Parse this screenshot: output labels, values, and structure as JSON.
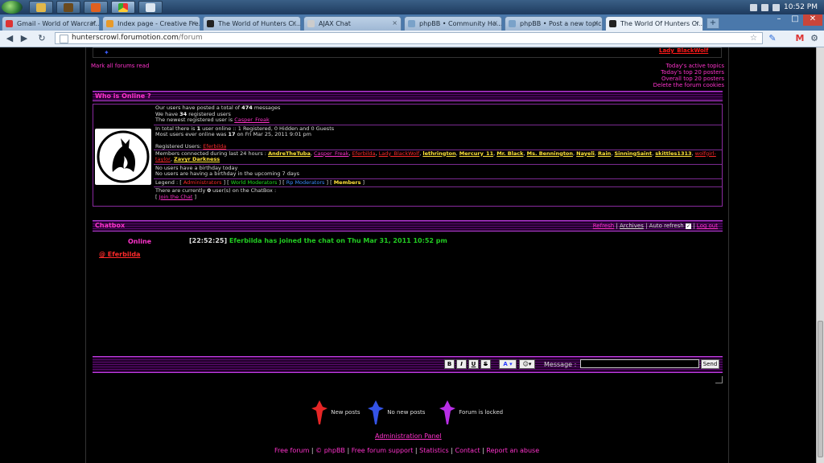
{
  "taskbar": {
    "time": "10:52 PM"
  },
  "browser": {
    "tabs": [
      {
        "label": "Gmail - World of Warcraf...",
        "color": "#d33"
      },
      {
        "label": "Index page - Creative Fre...",
        "color": "#e89a2a"
      },
      {
        "label": "The World of Hunters Cr...",
        "color": "#222"
      },
      {
        "label": "AJAX Chat",
        "color": "#ccc"
      },
      {
        "label": "phpBB • Community Ho...",
        "color": "#7aa2c9"
      },
      {
        "label": "phpBB • Post a new topic",
        "color": "#7aa2c9"
      },
      {
        "label": "The World Of Hunters Cr...",
        "color": "#222"
      }
    ],
    "url_host": "hunterscrowl.forumotion.com",
    "url_path": "/forum"
  },
  "forum": {
    "top_user": "Lady_BlackWolf",
    "mark_read": "Mark all forums read",
    "right_links": [
      "Today's active topics",
      "Today's top 20 posters",
      "Overall top 20 posters",
      "Delete the forum cookies"
    ],
    "who_title": "Who is Online ?",
    "stats": {
      "l1_pre": "Our users have posted a total of ",
      "posts": "474",
      "l1_post": " messages",
      "l2_pre": "We have ",
      "users": "34",
      "l2_post": " registered users",
      "l3_pre": "The newest registered user is ",
      "newest": "Casper_Freak",
      "l4_pre": "In total there is ",
      "online": "1",
      "l4_post": " user online :: 1 Registered, 0 Hidden and 0 Guests",
      "l5_pre": "Most users ever online was ",
      "max": "17",
      "l5_post": " on Fri Mar 25, 2011 9:01 pm",
      "registered_label": "Registered Users: ",
      "registered_user": "Eferbilda",
      "connected_label": "Members connected during last 24 hours : ",
      "connected": [
        {
          "name": "AndreTheTuba",
          "cls": "u-yel"
        },
        {
          "name": "Casper_Freak",
          "cls": "u-pink"
        },
        {
          "name": "Eferbilda",
          "cls": "u-red"
        },
        {
          "name": "Lady_BlackWolf",
          "cls": "u-red"
        },
        {
          "name": "lethrington",
          "cls": "u-yel"
        },
        {
          "name": "Mercury_11",
          "cls": "u-yel"
        },
        {
          "name": "Mr. Black",
          "cls": "u-yel"
        },
        {
          "name": "Ms. Bennington",
          "cls": "u-yel"
        },
        {
          "name": "Nayeli",
          "cls": "u-yel"
        },
        {
          "name": "Rain",
          "cls": "u-yel"
        },
        {
          "name": "SinningSaint",
          "cls": "u-yel"
        },
        {
          "name": "skittles1313",
          "cls": "u-yel"
        },
        {
          "name": "wolfgirl-taylor",
          "cls": "u-red"
        },
        {
          "name": "Zavyr Darkness",
          "cls": "u-yel"
        }
      ],
      "bday1": "No users have a birthday today",
      "bday2": "No users are having a birthday in the upcoming 7 days",
      "legend_label": "Legend : ",
      "legend": [
        "Administrators",
        "World Moderators",
        "Rp Moderators",
        "Members"
      ],
      "chat_pre": "There are currently ",
      "chat_count": "0",
      "chat_post": " user(s) on the ChatBox :",
      "join_chat": "Join the Chat"
    }
  },
  "chatbox": {
    "title": "Chatbox",
    "refresh": "Refresh",
    "archives": "Archives",
    "auto_refresh": "Auto refresh",
    "logout": "Log out",
    "online_label": "Online",
    "online_user": "@ Eferbilda",
    "message_time": "[22:52:25]",
    "message_text": "Eferbilda has joined the chat on Thu Mar 31, 2011 10:52 pm",
    "fmt": [
      "B",
      "I",
      "U",
      "S"
    ],
    "msg_label": "Message :",
    "send": "Send"
  },
  "legend_icons": {
    "new_posts": "New posts",
    "no_new_posts": "No new posts",
    "locked": "Forum is locked",
    "new_color": "#ff2a2a",
    "nonew_color": "#3a5cff",
    "locked_color": "#cc33ff"
  },
  "footer": {
    "admin_panel": "Administration Panel",
    "links": [
      "Free forum",
      "© phpBB",
      "Free forum support",
      "Statistics",
      "Contact",
      "Report an abuse"
    ]
  }
}
